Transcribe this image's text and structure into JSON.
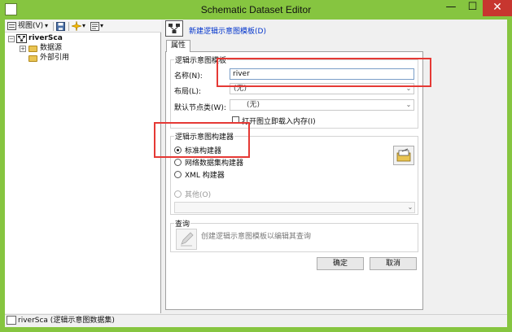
{
  "window": {
    "title": "Schematic Dataset Editor",
    "minimize": "—",
    "maximize": "☐",
    "close": "✕"
  },
  "toolbar": {
    "view_label": "视图(V)",
    "view_arrow": "▾",
    "new_arrow": "▾",
    "props_arrow": "▾"
  },
  "tree": {
    "root": {
      "label": "riverSca",
      "expander": "−"
    },
    "children": [
      {
        "label": "数据源",
        "expander": "+"
      },
      {
        "label": "外部引用"
      }
    ]
  },
  "status": {
    "text": "riverSca (逻辑示意图数据集)"
  },
  "header": {
    "link": "新建逻辑示意图模板(D)"
  },
  "tabs": [
    {
      "label": "属性"
    }
  ],
  "template_group": {
    "title": "逻辑示意图模板",
    "name_label": "名称(N):",
    "name_value": "river",
    "layout_label": "布局(L):",
    "layout_value": "(无)",
    "node_class_label": "默认节点类(W):",
    "node_class_value": "(无)",
    "load_checkbox_label": "打开图立即载入内存(I)",
    "load_checked": false
  },
  "builder_group": {
    "title": "逻辑示意图构建器",
    "options": [
      {
        "label": "标准构建器",
        "selected": true
      },
      {
        "label": "网络数据集构建器",
        "selected": false
      },
      {
        "label": "XML 构建器",
        "selected": false
      },
      {
        "label": "其他(O)",
        "selected": false,
        "disabled": true
      }
    ]
  },
  "query_group": {
    "title": "查询",
    "hint": "创建逻辑示意图模板以编辑其查询"
  },
  "buttons": {
    "ok": "确定",
    "cancel": "取消"
  },
  "colors": {
    "titlebar": "#86c540",
    "close": "#c7362f",
    "highlight": "#e53935",
    "link": "#0033cc"
  }
}
